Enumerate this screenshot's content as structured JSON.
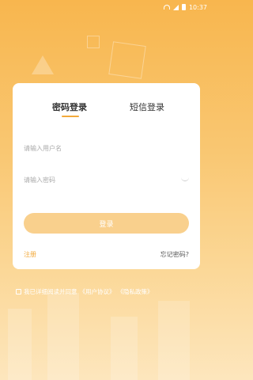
{
  "status_bar": {
    "time": "10:37"
  },
  "tabs": [
    {
      "label": "密码登录",
      "active": true
    },
    {
      "label": "短信登录",
      "active": false
    }
  ],
  "username": {
    "placeholder": "请输入用户名",
    "value": ""
  },
  "password": {
    "placeholder": "请输入密码",
    "value": ""
  },
  "login_button": {
    "label": "登录"
  },
  "register_link": {
    "label": "注册"
  },
  "forgot_link": {
    "label": "忘记密码?"
  },
  "agreement": {
    "prefix": "我已详细阅读并同意",
    "user_agreement": "《用户协议》",
    "privacy_policy": "《隐私政策》"
  },
  "colors": {
    "accent": "#f2a93b",
    "button": "#f9d08d",
    "background_top": "#f8b64e"
  }
}
